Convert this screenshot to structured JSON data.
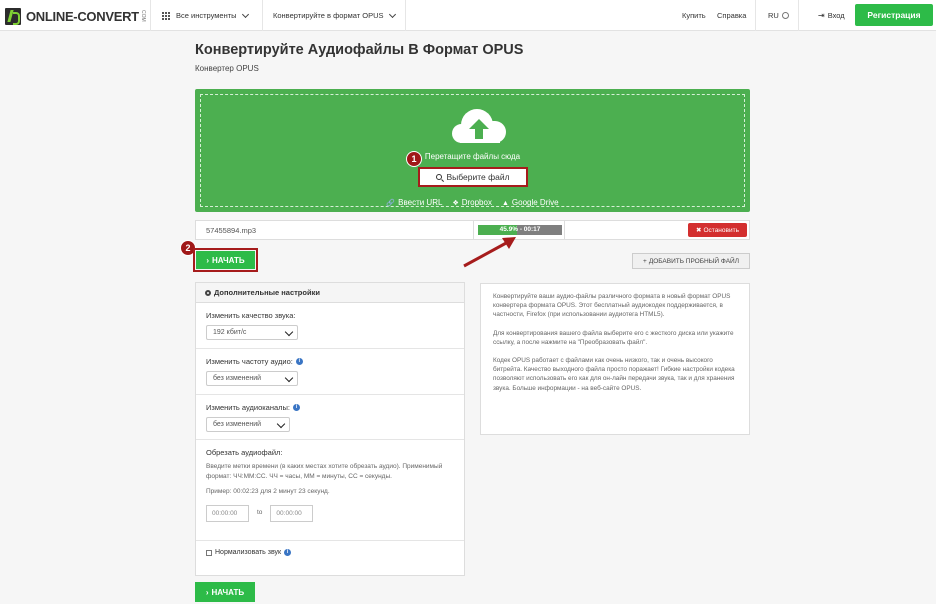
{
  "header": {
    "logo_text": "ONLINE-CONVERT",
    "logo_com": "COM",
    "nav_tools": "Все инструменты",
    "nav_convert": "Конвертируйте в формат OPUS",
    "buy": "Купить",
    "help": "Справка",
    "lang": "RU",
    "login": "Вход",
    "register": "Регистрация"
  },
  "page": {
    "title": "Конвертируйте Аудиофайлы В Формат OPUS",
    "subtitle": "Конвертер OPUS"
  },
  "upload": {
    "drop_text": "Перетащите файлы сюда",
    "choose_label": "Выберите файл",
    "url_label": "Ввести URL",
    "dropbox_label": "Dropbox",
    "gdrive_label": "Google Drive",
    "badge_1": "1",
    "badge_2": "2"
  },
  "file": {
    "name": "57455894.mp3",
    "progress_text": "45.9% - 00:17",
    "progress": 0.459,
    "stop_label": "Остановить"
  },
  "actions": {
    "start_label": "НАЧАТЬ",
    "sample_label": "ДОБАВИТЬ ПРОБНЫЙ ФАЙЛ"
  },
  "settings": {
    "title": "Дополнительные настройки",
    "quality_label": "Изменить качество звука:",
    "quality_value": "192 кбит/с",
    "freq_label": "Изменить частоту аудио:",
    "freq_value": "без изменений",
    "channels_label": "Изменить аудиоканалы:",
    "channels_value": "без изменений",
    "trim_label": "Обрезать аудиофайл:",
    "trim_help": "Введите метки времени (в каких местах хотите обрезать аудио). Применимый формат: ЧЧ:ММ:СС. ЧЧ = часы, ММ = минуты, СС = секунды.",
    "trim_example": "Пример: 00:02:23 для 2 минут 23 секунд.",
    "trim_from_placeholder": "00:00:00",
    "trim_to_label": "to",
    "trim_to_placeholder": "00:00:00",
    "normalize_label": "Нормализовать звук"
  },
  "info": {
    "p1": "Конвертируйте ваши аудио-файлы различного формата в новый формат OPUS конвертера формата OPUS. Этот бесплатный аудиокодек поддерживается, в частности, Firefox (при использовании аудиотега HTML5).",
    "p2": "Для конвертирования вашего файла выберите его с жесткого диска или укажите ссылку, а после нажмите на \"Преобразовать файл\".",
    "p3": "Кодек OPUS работает с файлами как очень низкого, так и очень высокого битрейта. Качество выходного файла просто поражает! Гибкие настройки кодека позволяют использовать его как для он-лайн передачи звука, так и для хранения звука. Больше информации - на веб-сайте OPUS."
  },
  "colors": {
    "green": "#4caf50",
    "button_green": "#2dbb48",
    "highlight_red": "#a61c1c",
    "stop_red": "#d32f2f"
  }
}
